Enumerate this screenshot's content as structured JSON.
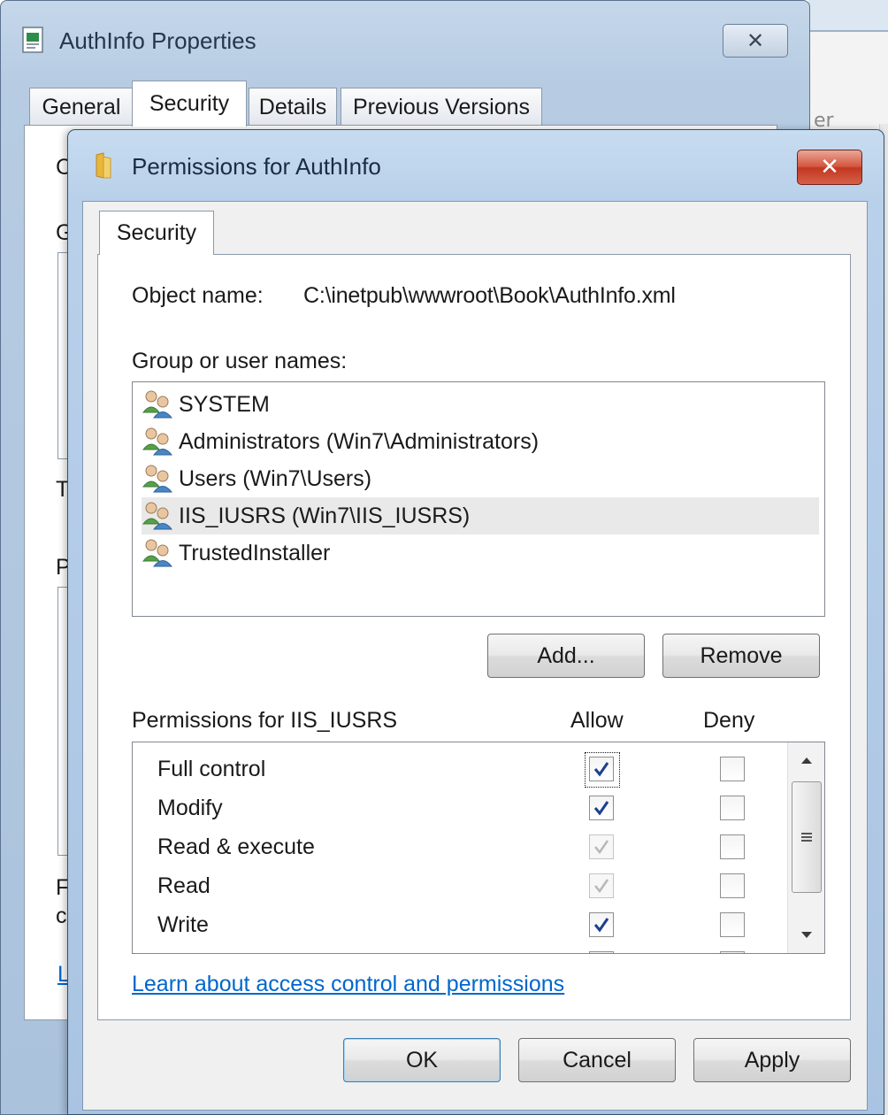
{
  "background": {
    "fragment_char": "er"
  },
  "properties_window": {
    "title": "AuthInfo Properties",
    "close_glyph": "✕",
    "tabs": [
      {
        "label": "General",
        "active": false
      },
      {
        "label": "Security",
        "active": true
      },
      {
        "label": "Details",
        "active": false
      },
      {
        "label": "Previous Versions",
        "active": false
      }
    ],
    "visible_fragments": [
      "C",
      "G",
      "T",
      "P",
      "F",
      "c",
      "L"
    ]
  },
  "permissions_dialog": {
    "title": "Permissions for AuthInfo",
    "close_glyph": "✕",
    "tab_label": "Security",
    "object_name_label": "Object name:",
    "object_name_value": "C:\\inetpub\\wwwroot\\Book\\AuthInfo.xml",
    "group_label": "Group or user names:",
    "users": [
      {
        "name": "SYSTEM",
        "selected": false
      },
      {
        "name": "Administrators (Win7\\Administrators)",
        "selected": false
      },
      {
        "name": "Users (Win7\\Users)",
        "selected": false
      },
      {
        "name": "IIS_IUSRS (Win7\\IIS_IUSRS)",
        "selected": true
      },
      {
        "name": "TrustedInstaller",
        "selected": false
      }
    ],
    "add_button": "Add...",
    "remove_button": "Remove",
    "permissions_header": "Permissions for IIS_IUSRS",
    "allow_header": "Allow",
    "deny_header": "Deny",
    "permissions": [
      {
        "name": "Full control",
        "allow": "checked",
        "deny": "unchecked"
      },
      {
        "name": "Modify",
        "allow": "checked",
        "deny": "unchecked"
      },
      {
        "name": "Read & execute",
        "allow": "inherited",
        "deny": "unchecked"
      },
      {
        "name": "Read",
        "allow": "inherited",
        "deny": "unchecked"
      },
      {
        "name": "Write",
        "allow": "checked",
        "deny": "unchecked"
      }
    ],
    "learn_link": "Learn about access control and permissions",
    "ok_button": "OK",
    "cancel_button": "Cancel",
    "apply_button": "Apply"
  },
  "colors": {
    "link": "#0066cc",
    "check_active": "#1c3f8f",
    "check_inherited": "#b8b8b8",
    "close_red": "#c3371f"
  },
  "icons": {
    "properties_window": "file-properties-icon",
    "permissions_dialog": "folder-icon",
    "user": "user-group-icon"
  }
}
